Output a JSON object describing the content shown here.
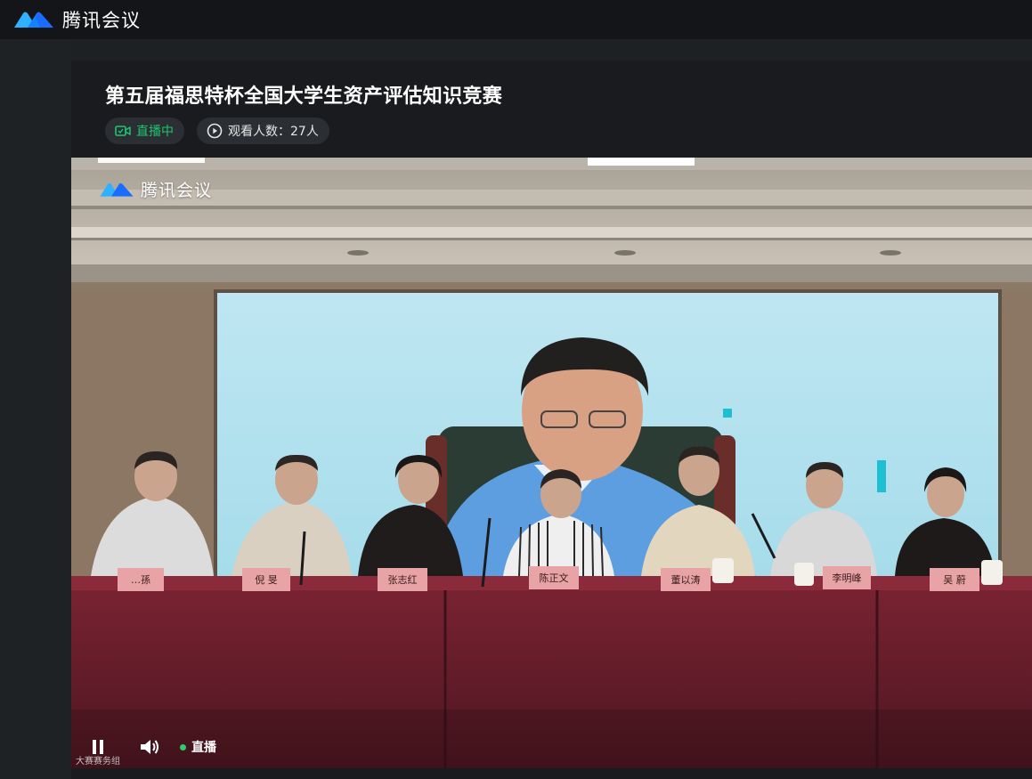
{
  "app": {
    "name": "腾讯会议",
    "brand_colors": [
      "#2fb1ff",
      "#1a6cff"
    ]
  },
  "meeting": {
    "title": "第五届福思特杯全国大学生资产评估知识竞赛",
    "status_label": "直播中",
    "status_color": "#1fc46f",
    "viewers_label": "观看人数：27人"
  },
  "video": {
    "watermark": "腾讯会议",
    "nameplates": [
      "…孫",
      "倪 旻",
      "张志红",
      "陈正文",
      "董以涛",
      "李明峰",
      "吴 蔚"
    ],
    "live_label": "直播",
    "caption": "大赛赛务组",
    "icons": {
      "pause": "pause-icon",
      "volume": "volume-icon",
      "live": "live-dot-icon"
    }
  }
}
